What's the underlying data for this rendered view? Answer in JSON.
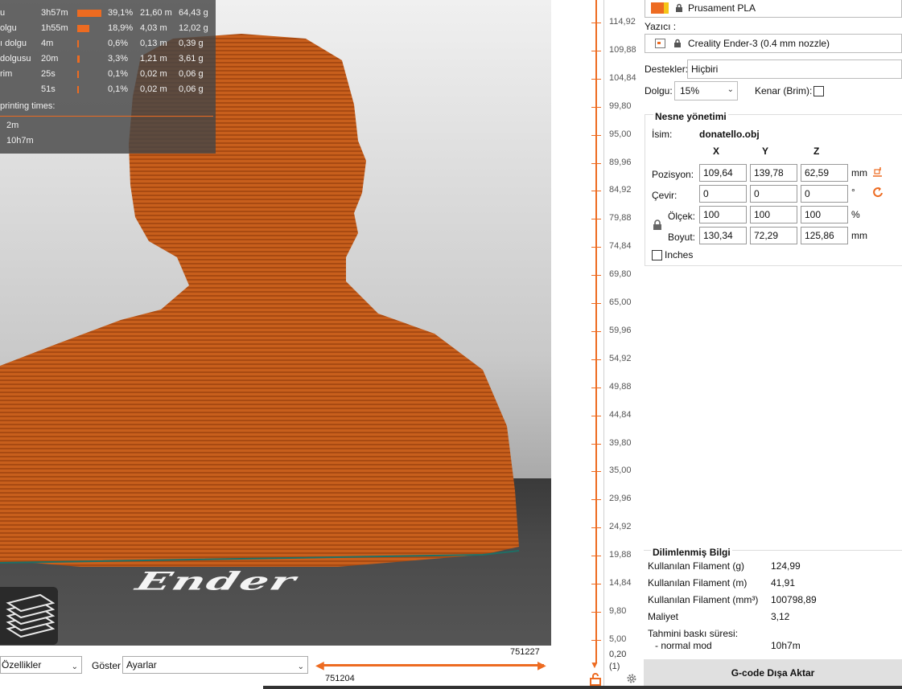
{
  "stats": {
    "rows": [
      {
        "name": "",
        "time": "",
        "pct": "",
        "len": "",
        "weight": "",
        "bar": 0
      },
      {
        "name": "u",
        "time": "3h57m",
        "pct": "39,1%",
        "len": "21,60 m",
        "weight": "64,43 g",
        "bar": 0.391
      },
      {
        "name": "olgu",
        "time": "1h55m",
        "pct": "18,9%",
        "len": "4,03 m",
        "weight": "12,02 g",
        "bar": 0.189
      },
      {
        "name": "ı dolgu",
        "time": "4m",
        "pct": "0,6%",
        "len": "0,13 m",
        "weight": "0,39 g",
        "bar": 0.006
      },
      {
        "name": "dolgusu",
        "time": "20m",
        "pct": "3,3%",
        "len": "1,21 m",
        "weight": "3,61 g",
        "bar": 0.033
      },
      {
        "name": "rim",
        "time": "25s",
        "pct": "0,1%",
        "len": "0,02 m",
        "weight": "0,06 g",
        "bar": 0.001
      },
      {
        "name": "",
        "time": "51s",
        "pct": "0,1%",
        "len": "0,02 m",
        "weight": "0,06 g",
        "bar": 0.001
      }
    ],
    "printing_times_title": "printing times:",
    "time_1": "2m",
    "time_2": "10h7m"
  },
  "bottom": {
    "feature_select": "Özellikler",
    "show_label": "Göster",
    "show_select": "Ayarlar",
    "move_top": "751227",
    "move_bottom": "751204"
  },
  "vslider": {
    "ticks": [
      "114,92",
      "109,88",
      "104,84",
      "99,80",
      "95,00",
      "89,96",
      "84,92",
      "79,88",
      "74,84",
      "69,80",
      "65,00",
      "59,96",
      "54,92",
      "49,88",
      "44,84",
      "39,80",
      "35,00",
      "29,96",
      "24,92",
      "19,88",
      "14,84",
      "9,80",
      "5,00"
    ],
    "bottom_value": "0,20",
    "bottom_index": "(1)"
  },
  "panel": {
    "filament": "Prusament PLA",
    "filament_colors": [
      "#ed6b21",
      "#f5c518"
    ],
    "printer_label": "Yazıcı :",
    "printer": "Creality Ender-3 (0.4 mm nozzle)",
    "supports_label": "Destekler:",
    "supports": "Hiçbiri",
    "infill_label": "Dolgu:",
    "infill": "15%",
    "brim_label": "Kenar (Brim):",
    "object_manager": {
      "title": "Nesne yönetimi",
      "name_label": "İsim:",
      "name": "donatello.obj",
      "axis_x": "X",
      "axis_y": "Y",
      "axis_z": "Z",
      "position_label": "Pozisyon:",
      "position": [
        "109,64",
        "139,78",
        "62,59"
      ],
      "position_unit": "mm",
      "rotate_label": "Çevir:",
      "rotate": [
        "0",
        "0",
        "0"
      ],
      "rotate_unit": "°",
      "scale_label": "Ölçek:",
      "scale": [
        "100",
        "100",
        "100"
      ],
      "scale_unit": "%",
      "size_label": "Boyut:",
      "size": [
        "130,34",
        "72,29",
        "125,86"
      ],
      "size_unit": "mm",
      "inches_label": "Inches"
    },
    "sliced_info": {
      "title": "Dilimlenmiş Bilgi",
      "rows": [
        {
          "key": "Kullanılan Filament (g)",
          "value": "124,99"
        },
        {
          "key": "Kullanılan Filament (m)",
          "value": "41,91"
        },
        {
          "key": "Kullanılan Filament (mm³)",
          "value": "100798,89"
        },
        {
          "key": "Maliyet",
          "value": "3,12"
        }
      ],
      "est_time_label": "Tahmini baskı süresi:",
      "normal_mode_label": "- normal mod",
      "normal_mode_value": "10h7m"
    },
    "export_button": "G-code Dışa Aktar"
  },
  "bed_logo": "Ender"
}
